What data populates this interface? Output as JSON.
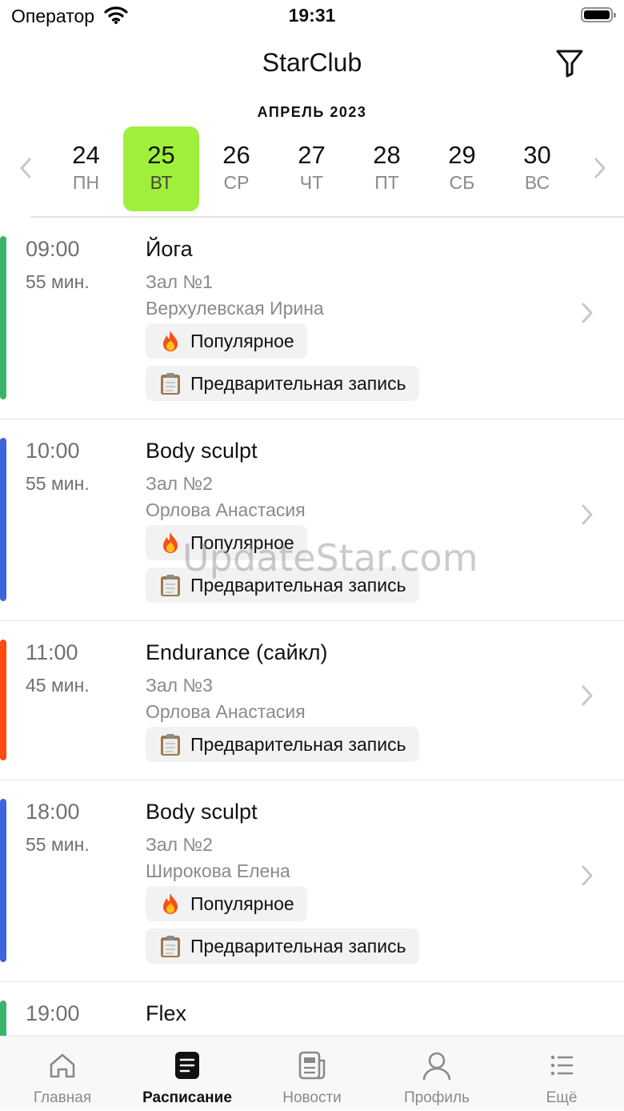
{
  "status_bar": {
    "carrier": "Оператор",
    "time": "19:31"
  },
  "header": {
    "title": "StarClub"
  },
  "calendar": {
    "month": "АПРЕЛЬ 2023",
    "days": [
      {
        "num": "24",
        "name": "ПН",
        "selected": false
      },
      {
        "num": "25",
        "name": "ВТ",
        "selected": true
      },
      {
        "num": "26",
        "name": "СР",
        "selected": false
      },
      {
        "num": "27",
        "name": "ЧТ",
        "selected": false
      },
      {
        "num": "28",
        "name": "ПТ",
        "selected": false
      },
      {
        "num": "29",
        "name": "СБ",
        "selected": false
      },
      {
        "num": "30",
        "name": "ВС",
        "selected": false
      }
    ],
    "selected_color": "#9ef03a"
  },
  "tags": {
    "popular": "Популярное",
    "booking": "Предварительная запись"
  },
  "classes": [
    {
      "time": "09:00",
      "duration": "55 мин.",
      "title": "Йога",
      "hall": "Зал №1",
      "trainer": "Верхулевская Ирина",
      "popular": true,
      "booking": true,
      "color": "#3ab36b"
    },
    {
      "time": "10:00",
      "duration": "55 мин.",
      "title": "Body sculpt",
      "hall": "Зал №2",
      "trainer": "Орлова Анастасия",
      "popular": true,
      "booking": true,
      "color": "#3d63dd"
    },
    {
      "time": "11:00",
      "duration": "45 мин.",
      "title": "Endurance (сайкл)",
      "hall": "Зал №3",
      "trainer": "Орлова Анастасия",
      "popular": false,
      "booking": true,
      "color": "#ff4a12"
    },
    {
      "time": "18:00",
      "duration": "55 мин.",
      "title": "Body sculpt",
      "hall": "Зал №2",
      "trainer": "Широкова Елена",
      "popular": true,
      "booking": true,
      "color": "#3d63dd"
    },
    {
      "time": "19:00",
      "duration": "",
      "title": "Flex",
      "hall": "",
      "trainer": "",
      "popular": false,
      "booking": false,
      "color": "#3ab36b"
    }
  ],
  "watermark": "UpdateStar.com",
  "tab_bar": {
    "items": [
      {
        "label": "Главная",
        "icon": "home-icon",
        "active": false
      },
      {
        "label": "Расписание",
        "icon": "schedule-icon",
        "active": true
      },
      {
        "label": "Новости",
        "icon": "news-icon",
        "active": false
      },
      {
        "label": "Профиль",
        "icon": "profile-icon",
        "active": false
      },
      {
        "label": "Ещё",
        "icon": "more-icon",
        "active": false
      }
    ]
  }
}
